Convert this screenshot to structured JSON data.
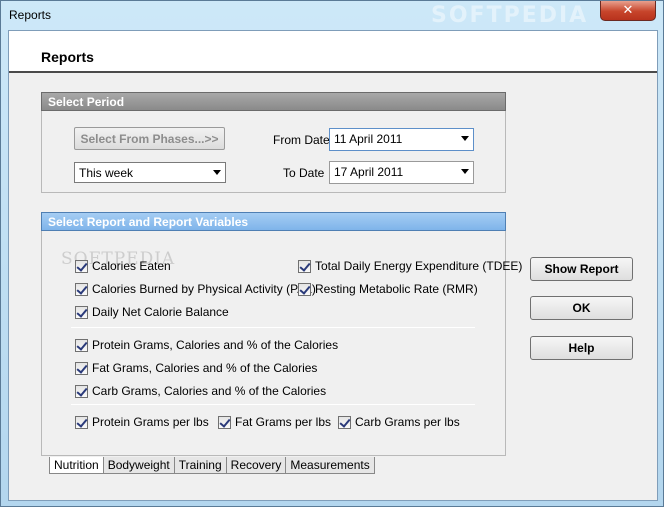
{
  "window": {
    "title": "Reports",
    "watermark": "SOFTPEDIA",
    "close_glyph": "✕"
  },
  "header": {
    "title": "Reports"
  },
  "period": {
    "heading": "Select Period",
    "phases_button": "Select From Phases...>>",
    "range_select": "This week",
    "from_label": "From Date",
    "from_value": "11 April 2011",
    "to_label": "To Date",
    "to_value": "17 April 2011"
  },
  "report": {
    "heading": "Select Report and Report Variables",
    "watermark": "SOFTPEDIA",
    "items": {
      "calories_eaten": "Calories Eaten",
      "calories_burned": "Calories Burned by Physical Activity (PAL)",
      "net_balance": "Daily Net Calorie Balance",
      "tdee": "Total Daily Energy Expenditure (TDEE)",
      "rmr": "Resting Metabolic Rate (RMR)",
      "protein": "Protein Grams, Calories and % of the Calories",
      "fat": "Fat Grams, Calories and % of the Calories",
      "carb": "Carb Grams, Calories and % of the Calories",
      "protein_lbs": "Protein Grams per lbs",
      "fat_lbs": "Fat Grams per lbs",
      "carb_lbs": "Carb Grams per lbs"
    }
  },
  "actions": {
    "show_report": "Show Report",
    "ok": "OK",
    "help": "Help"
  },
  "tabs": [
    "Nutrition",
    "Bodyweight",
    "Training",
    "Recovery",
    "Measurements"
  ]
}
